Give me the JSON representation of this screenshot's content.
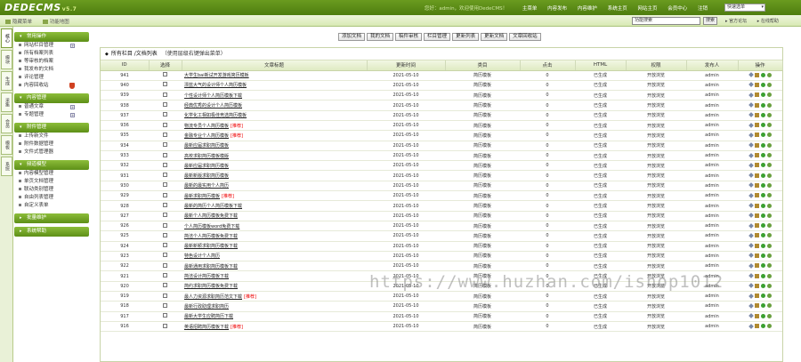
{
  "header": {
    "logo": "DEDECMS",
    "version": "v5.7",
    "greeting": "您好：admin，欢迎使用DedeCMS！",
    "nav": [
      "主菜单",
      "内容发布",
      "内容维护",
      "系统主页",
      "网站主页",
      "会员中心",
      "注销"
    ],
    "quick_select": "快速选单"
  },
  "subbar": {
    "items": [
      "隐藏菜单",
      "功能地图"
    ],
    "search_placeholder": "功能搜索",
    "search_button": "搜索",
    "right_links": [
      "官方论坛",
      "在线帮助"
    ]
  },
  "vtabs": [
    "核心",
    "模块",
    "生成",
    "采集",
    "会员",
    "模板",
    "系统"
  ],
  "menu": [
    {
      "title": "常用操作",
      "collapsed": false,
      "items": [
        {
          "label": "网站栏目管理",
          "add": true
        },
        {
          "label": "所有档案列表",
          "add": false
        },
        {
          "label": "等审核的档案",
          "add": false
        },
        {
          "label": "我发布的文档",
          "add": false
        },
        {
          "label": "评论管理",
          "add": false
        },
        {
          "label": "内容回收站",
          "shield": true
        }
      ]
    },
    {
      "title": "内容管理",
      "collapsed": false,
      "items": [
        {
          "label": "普通文章",
          "add": true
        },
        {
          "label": "专题管理",
          "add": true
        }
      ]
    },
    {
      "title": "附件管理",
      "collapsed": false,
      "items": [
        {
          "label": "上传新文件"
        },
        {
          "label": "附件数据管理"
        },
        {
          "label": "文件式管理器"
        }
      ]
    },
    {
      "title": "频道模型",
      "collapsed": false,
      "items": [
        {
          "label": "内容模型管理"
        },
        {
          "label": "单页文档管理"
        },
        {
          "label": "联动类别管理"
        },
        {
          "label": "自由列表管理"
        },
        {
          "label": "自定义表单"
        }
      ]
    },
    {
      "title": "批量维护",
      "collapsed": true,
      "items": []
    },
    {
      "title": "系统帮助",
      "collapsed": true,
      "items": []
    }
  ],
  "toolbar": [
    "添加文档",
    "我的文档",
    "稿件审核",
    "栏目管理",
    "更新列表",
    "更新文档",
    "文章回收站"
  ],
  "panel": {
    "title": "所有栏目 /文档列表",
    "note": "（使用层级右键弹出菜单）"
  },
  "columns": [
    "ID",
    "选择",
    "文章标题",
    "更新时间",
    "类目",
    "点击",
    "HTML",
    "权限",
    "发布人",
    "操作"
  ],
  "rows": [
    {
      "id": "941",
      "title": "大学生bai新试开发游戏简历模板",
      "date": "2021-05-10",
      "cat": "简历模板",
      "click": "0",
      "html": "已生成",
      "perm": "开放浏览",
      "author": "admin"
    },
    {
      "id": "940",
      "title": "漂蓝大气的设计师个人简历模板",
      "date": "2021-05-10",
      "cat": "简历模板",
      "click": "0",
      "html": "已生成",
      "perm": "开放浏览",
      "author": "admin"
    },
    {
      "id": "939",
      "title": "个性设计师个人简历模板下载",
      "date": "2021-05-10",
      "cat": "简历模板",
      "click": "0",
      "html": "已生成",
      "perm": "开放浏览",
      "author": "admin"
    },
    {
      "id": "938",
      "title": "经典优秀的设计个人简历模板",
      "date": "2021-05-10",
      "cat": "简历模板",
      "click": "0",
      "html": "已生成",
      "perm": "开放浏览",
      "author": "admin"
    },
    {
      "id": "937",
      "title": "化学化工相如极佳竞选简历模板",
      "date": "2021-05-10",
      "cat": "简历模板",
      "click": "0",
      "html": "已生成",
      "perm": "开放浏览",
      "author": "admin"
    },
    {
      "id": "936",
      "title": "物流专员个人简历模板",
      "rec": "[推荐]",
      "date": "2021-05-10",
      "cat": "简历模板",
      "click": "0",
      "html": "已生成",
      "perm": "开放浏览",
      "author": "admin"
    },
    {
      "id": "935",
      "title": "金融专业个人简历模板",
      "rec": "[推荐]",
      "date": "2021-05-10",
      "cat": "简历模板",
      "click": "0",
      "html": "已生成",
      "perm": "开放浏览",
      "author": "admin"
    },
    {
      "id": "934",
      "title": "最新应届求职简历模板",
      "date": "2021-05-10",
      "cat": "简历模板",
      "click": "0",
      "html": "已生成",
      "perm": "开放浏览",
      "author": "admin"
    },
    {
      "id": "933",
      "title": "高校求职简历模板模版",
      "date": "2021-05-10",
      "cat": "简历模板",
      "click": "0",
      "html": "已生成",
      "perm": "开放浏览",
      "author": "admin"
    },
    {
      "id": "932",
      "title": "最新应届求职简历模板",
      "date": "2021-05-10",
      "cat": "简历模板",
      "click": "0",
      "html": "已生成",
      "perm": "开放浏览",
      "author": "admin"
    },
    {
      "id": "931",
      "title": "最新新版求职简历模板",
      "date": "2021-05-10",
      "cat": "简历模板",
      "click": "0",
      "html": "已生成",
      "perm": "开放浏览",
      "author": "admin"
    },
    {
      "id": "930",
      "title": "最新的最实用个人简历",
      "date": "2021-05-10",
      "cat": "简历模板",
      "click": "0",
      "html": "已生成",
      "perm": "开放浏览",
      "author": "admin"
    },
    {
      "id": "929",
      "title": "最新求职简历模板",
      "rec": "[推荐]",
      "date": "2021-05-10",
      "cat": "简历模板",
      "click": "0",
      "html": "已生成",
      "perm": "开放浏览",
      "author": "admin"
    },
    {
      "id": "928",
      "title": "最新的简历个人简历模板下载",
      "date": "2021-05-10",
      "cat": "简历模板",
      "click": "0",
      "html": "已生成",
      "perm": "开放浏览",
      "author": "admin"
    },
    {
      "id": "927",
      "title": "最新个人简历模板免费下载",
      "date": "2021-05-10",
      "cat": "简历模板",
      "click": "0",
      "html": "已生成",
      "perm": "开放浏览",
      "author": "admin"
    },
    {
      "id": "926",
      "title": "个人简历模板word免费下载",
      "date": "2021-05-10",
      "cat": "简历模板",
      "click": "0",
      "html": "已生成",
      "perm": "开放浏览",
      "author": "admin"
    },
    {
      "id": "925",
      "title": "简洁个人简历模板免费下载",
      "date": "2021-05-10",
      "cat": "简历模板",
      "click": "0",
      "html": "已生成",
      "perm": "开放浏览",
      "author": "admin"
    },
    {
      "id": "924",
      "title": "最新新颖求职简历模板下载",
      "date": "2021-05-10",
      "cat": "简历模板",
      "click": "0",
      "html": "已生成",
      "perm": "开放浏览",
      "author": "admin"
    },
    {
      "id": "923",
      "title": "特色设计个人简历",
      "date": "2021-05-10",
      "cat": "简历模板",
      "click": "0",
      "html": "已生成",
      "perm": "开放浏览",
      "author": "admin"
    },
    {
      "id": "922",
      "title": "最新通用求职简历模板下载",
      "date": "2021-05-10",
      "cat": "简历模板",
      "click": "0",
      "html": "已生成",
      "perm": "开放浏览",
      "author": "admin"
    },
    {
      "id": "921",
      "title": "简洁设计简历模板下载",
      "date": "2021-05-10",
      "cat": "简历模板",
      "click": "0",
      "html": "已生成",
      "perm": "开放浏览",
      "author": "admin"
    },
    {
      "id": "920",
      "title": "简约求职简历模板免费下载",
      "date": "2021-05-10",
      "cat": "简历模板",
      "click": "0",
      "html": "已生成",
      "perm": "开放浏览",
      "author": "admin"
    },
    {
      "id": "919",
      "title": "最人力资源求职简历范文下载",
      "rec": "[推荐]",
      "date": "2021-05-10",
      "cat": "简历模板",
      "click": "0",
      "html": "已生成",
      "perm": "开放浏览",
      "author": "admin"
    },
    {
      "id": "918",
      "title": "最新行政助理求职简历",
      "date": "2021-05-10",
      "cat": "简历模板",
      "click": "0",
      "html": "已生成",
      "perm": "开放浏览",
      "author": "admin"
    },
    {
      "id": "917",
      "title": "最新大学生应聘简历下载",
      "date": "2021-05-10",
      "cat": "简历模板",
      "click": "0",
      "html": "已生成",
      "perm": "开放浏览",
      "author": "admin"
    },
    {
      "id": "916",
      "title": "英语招聘简历模板下载",
      "rec": "[推荐]",
      "date": "2021-05-10",
      "cat": "简历模板",
      "click": "0",
      "html": "已生成",
      "perm": "开放浏览",
      "author": "admin"
    }
  ],
  "watermark": "https://www.huzhan.com/ishop1012"
}
